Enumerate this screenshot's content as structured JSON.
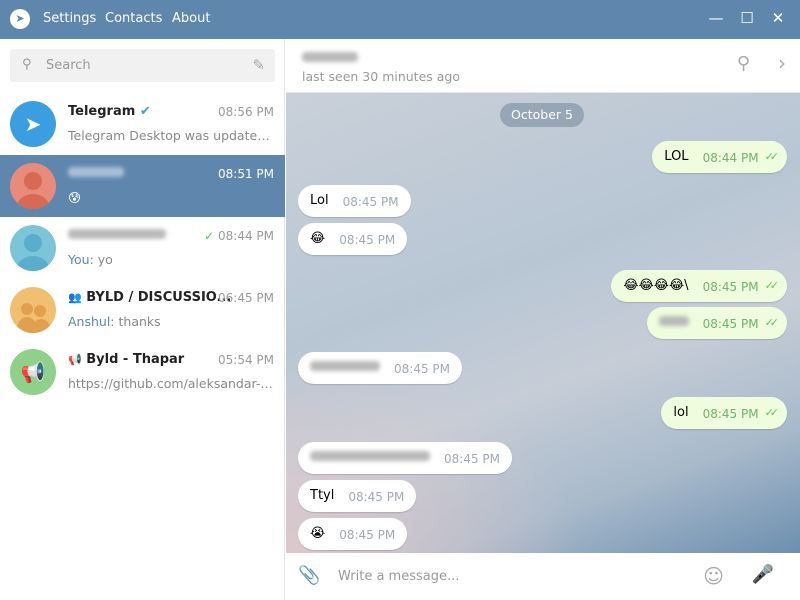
{
  "titlebar": {
    "menu": [
      "Settings",
      "Contacts",
      "About"
    ],
    "controls": {
      "minimize": "—",
      "maximize": "☐",
      "close": "✕"
    }
  },
  "sidebar": {
    "search_placeholder": "Search",
    "chats": [
      {
        "name": "Telegram",
        "verified": true,
        "time": "08:56 PM",
        "preview": "Telegram Desktop was updated t...",
        "avatar_color": "#3a9ee0"
      },
      {
        "name": "",
        "time": "08:51 PM",
        "preview": "😰",
        "selected": true,
        "avatar_color": "#e88b7a"
      },
      {
        "name": "",
        "time": "08:44 PM",
        "sender": "You:",
        "preview": "yo",
        "read": true,
        "avatar_color": "#7cc4da"
      },
      {
        "name": "BYLD / DISCUSSIO...",
        "type": "group",
        "time": "06:45 PM",
        "sender": "Anshul:",
        "preview": "thanks",
        "avatar_color": "#f0c070"
      },
      {
        "name": "Byld - Thapar",
        "type": "channel",
        "time": "05:54 PM",
        "preview": "https://github.com/aleksandar-t...",
        "avatar_color": "#8fd18a"
      }
    ]
  },
  "header": {
    "name": "",
    "status": "last seen 30 minutes ago"
  },
  "chat": {
    "date": "October 5",
    "messages": [
      {
        "text": "LOL",
        "time": "08:44 PM",
        "out": true
      },
      {
        "text": "Lol",
        "time": "08:45 PM",
        "out": false
      },
      {
        "text": "😂",
        "time": "08:45 PM",
        "out": false
      },
      {
        "text": "😂😂😂😂\\",
        "time": "08:45 PM",
        "out": true
      },
      {
        "text": "",
        "time": "08:45 PM",
        "out": true
      },
      {
        "text": "",
        "time": "08:45 PM",
        "out": false
      },
      {
        "text": "lol",
        "time": "08:45 PM",
        "out": true
      },
      {
        "text": "",
        "time": "08:45 PM",
        "out": false
      },
      {
        "text": "Ttyl",
        "time": "08:45 PM",
        "out": false
      },
      {
        "text": "😭",
        "time": "08:45 PM",
        "out": false
      }
    ]
  },
  "composer": {
    "placeholder": "Write a message..."
  }
}
